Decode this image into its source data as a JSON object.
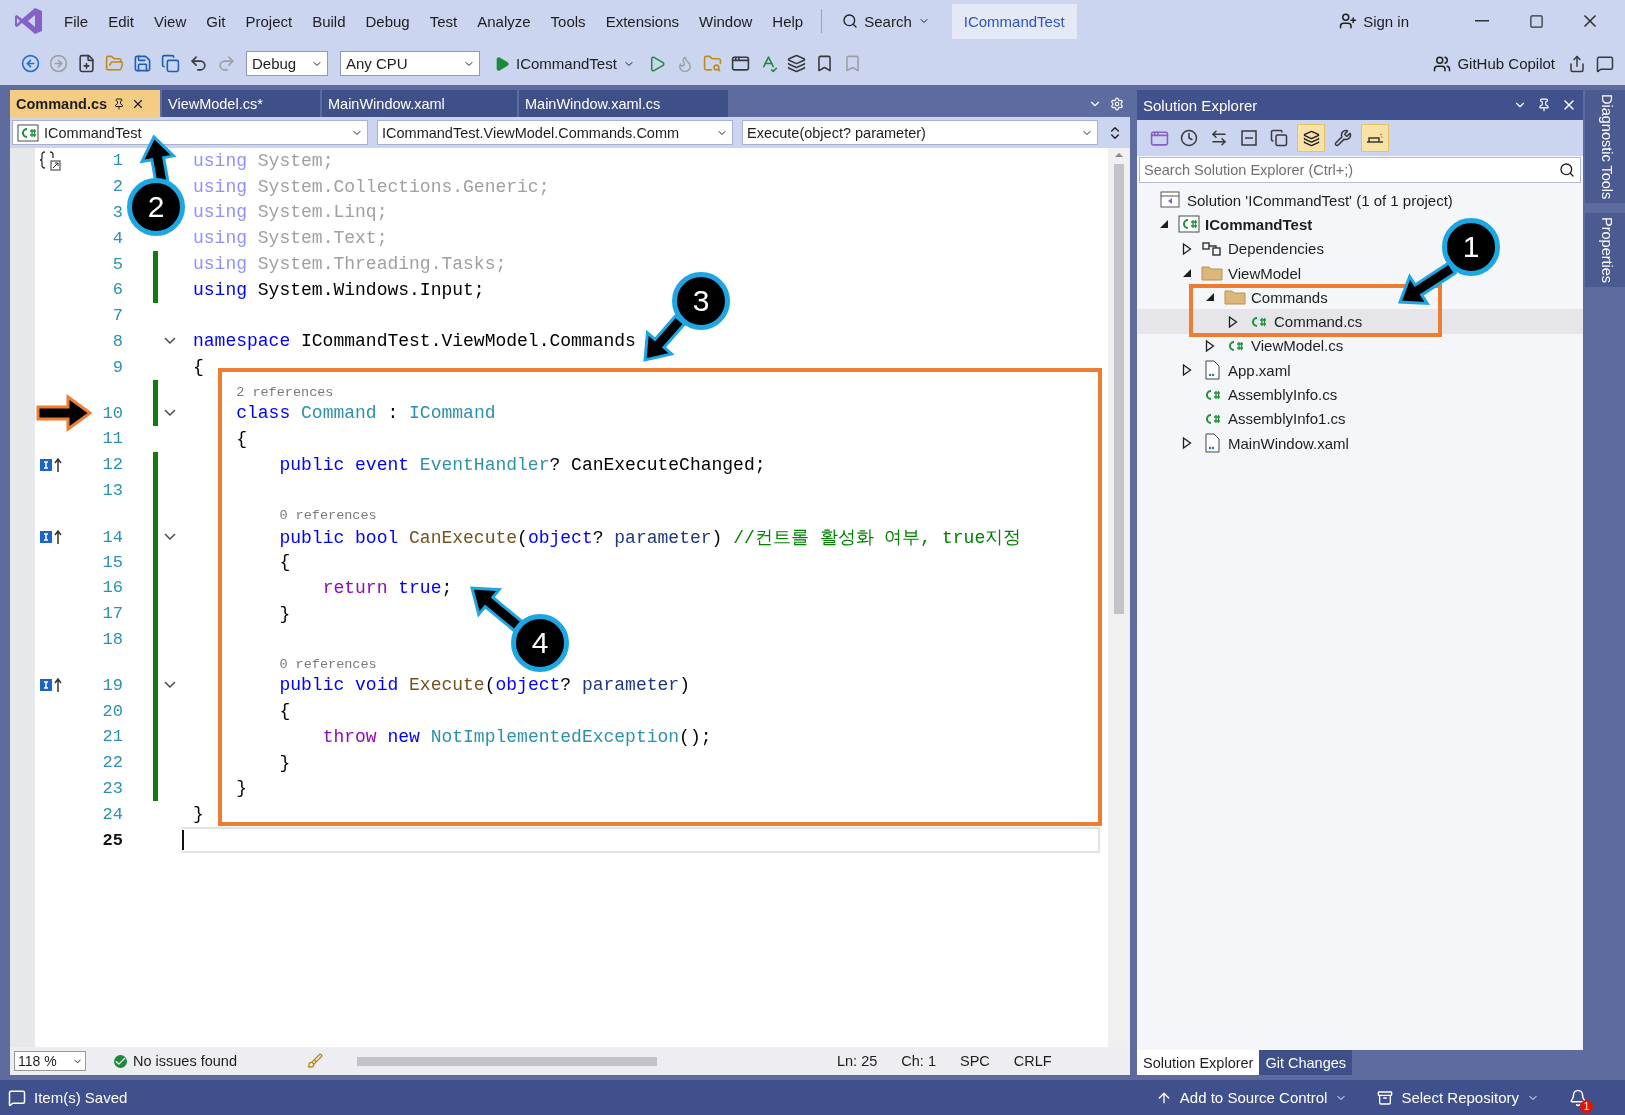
{
  "window": {
    "menu": [
      "File",
      "Edit",
      "View",
      "Git",
      "Project",
      "Build",
      "Debug",
      "Test",
      "Analyze",
      "Tools",
      "Extensions",
      "Window",
      "Help"
    ],
    "search": "Search",
    "solution_name": "ICommandTest",
    "sign_in": "Sign in"
  },
  "toolbar": {
    "configuration": "Debug",
    "platform": "Any CPU",
    "startup_project": "ICommandTest",
    "copilot": "GitHub Copilot"
  },
  "document_tabs": [
    {
      "label": "Command.cs",
      "selected": true
    },
    {
      "label": "ViewModel.cs*",
      "selected": false
    },
    {
      "label": "MainWindow.xaml",
      "selected": false
    },
    {
      "label": "MainWindow.xaml.cs",
      "selected": false
    }
  ],
  "navigation_bar": {
    "project": "ICommandTest",
    "type": "ICommandTest.ViewModel.Commands.Comm",
    "member": "Execute(object? parameter)"
  },
  "code_lines": [
    {
      "kind": "code",
      "number": "1",
      "changed": false,
      "current": false,
      "margin_icon": {
        "kind": "usings"
      },
      "tokens": [
        {
          "text": "using",
          "color": "#9090ff"
        },
        {
          "text": " System;",
          "color": "#a0a0a0"
        }
      ]
    },
    {
      "kind": "code",
      "number": "2",
      "changed": false,
      "current": false,
      "tokens": [
        {
          "text": "using",
          "color": "#9090ff"
        },
        {
          "text": " System.Collections.Generic;",
          "color": "#a0a0a0"
        }
      ]
    },
    {
      "kind": "code",
      "number": "3",
      "changed": false,
      "current": false,
      "tokens": [
        {
          "text": "using",
          "color": "#9090ff"
        },
        {
          "text": " System.Linq;",
          "color": "#a0a0a0"
        }
      ]
    },
    {
      "kind": "code",
      "number": "4",
      "changed": false,
      "current": false,
      "tokens": [
        {
          "text": "using",
          "color": "#9090ff"
        },
        {
          "text": " System.Text;",
          "color": "#a0a0a0"
        }
      ]
    },
    {
      "kind": "code",
      "number": "5",
      "changed": true,
      "current": false,
      "tokens": [
        {
          "text": "using",
          "color": "#9090ff"
        },
        {
          "text": " System.Threading.Tasks;",
          "color": "#a0a0a0"
        }
      ]
    },
    {
      "kind": "code",
      "number": "6",
      "changed": true,
      "current": false,
      "tokens": [
        {
          "text": "using",
          "color": "#0000ff"
        },
        {
          "text": " System.Windows.Input;",
          "color": "#000000"
        }
      ]
    },
    {
      "kind": "code",
      "number": "7",
      "changed": false,
      "current": false
    },
    {
      "kind": "code",
      "number": "8",
      "changed": false,
      "current": false,
      "expanded": true,
      "tokens": [
        {
          "text": "namespace",
          "color": "#0000ff"
        },
        {
          "text": " ICommandTest.ViewModel.Commands",
          "color": "#000000"
        }
      ]
    },
    {
      "kind": "code",
      "number": "9",
      "changed": false,
      "current": false,
      "tokens": [
        {
          "text": "{",
          "color": "#000000"
        }
      ]
    },
    {
      "kind": "lens",
      "changed": true,
      "text": "    2 references"
    },
    {
      "kind": "code",
      "number": "10",
      "changed": true,
      "current": false,
      "expanded": true,
      "tokens": [
        {
          "text": "    class",
          "color": "#0000ff"
        },
        {
          "text": " Command",
          "color": "#2b91af"
        },
        {
          "text": " :",
          "color": "#000000"
        },
        {
          "text": " ICommand",
          "color": "#2b91af"
        }
      ]
    },
    {
      "kind": "code",
      "number": "11",
      "changed": false,
      "current": false,
      "tokens": [
        {
          "text": "    {",
          "color": "#000000"
        }
      ]
    },
    {
      "kind": "code",
      "number": "12",
      "changed": true,
      "current": false,
      "margin_icon": {
        "kind": "implements"
      },
      "tokens": [
        {
          "text": "        public",
          "color": "#0000ff"
        },
        {
          "text": " event",
          "color": "#0000ff"
        },
        {
          "text": " EventHandler",
          "color": "#2b91af"
        },
        {
          "text": "? CanExecuteChanged;",
          "color": "#000000"
        }
      ]
    },
    {
      "kind": "code",
      "number": "13",
      "changed": true,
      "current": false
    },
    {
      "kind": "lens",
      "changed": true,
      "text": "        0 references"
    },
    {
      "kind": "code",
      "number": "14",
      "changed": true,
      "current": false,
      "expanded": true,
      "margin_icon": {
        "kind": "implements"
      },
      "tokens": [
        {
          "text": "        public",
          "color": "#0000ff"
        },
        {
          "text": " bool",
          "color": "#0000ff"
        },
        {
          "text": " CanExecute",
          "color": "#74531f"
        },
        {
          "text": "(",
          "color": "#000000"
        },
        {
          "text": "object",
          "color": "#0000ff"
        },
        {
          "text": "?",
          "color": "#000000"
        },
        {
          "text": " parameter",
          "color": "#1f377f"
        },
        {
          "text": ")",
          "color": "#000000"
        },
        {
          "text": " //컨트롤 활성화 여부, true지정",
          "color": "#008000"
        }
      ]
    },
    {
      "kind": "code",
      "number": "15",
      "changed": true,
      "current": false,
      "tokens": [
        {
          "text": "        {",
          "color": "#000000"
        }
      ]
    },
    {
      "kind": "code",
      "number": "16",
      "changed": true,
      "current": false,
      "tokens": [
        {
          "text": "            return",
          "color": "#8f08c4"
        },
        {
          "text": " true",
          "color": "#0000ff"
        },
        {
          "text": ";",
          "color": "#000000"
        }
      ]
    },
    {
      "kind": "code",
      "number": "17",
      "changed": true,
      "current": false,
      "tokens": [
        {
          "text": "        }",
          "color": "#000000"
        }
      ]
    },
    {
      "kind": "code",
      "number": "18",
      "changed": true,
      "current": false
    },
    {
      "kind": "lens",
      "changed": true,
      "text": "        0 references"
    },
    {
      "kind": "code",
      "number": "19",
      "changed": true,
      "current": false,
      "expanded": true,
      "margin_icon": {
        "kind": "implements"
      },
      "tokens": [
        {
          "text": "        public",
          "color": "#0000ff"
        },
        {
          "text": " void",
          "color": "#0000ff"
        },
        {
          "text": " Execute",
          "color": "#74531f"
        },
        {
          "text": "(",
          "color": "#000000"
        },
        {
          "text": "object",
          "color": "#0000ff"
        },
        {
          "text": "?",
          "color": "#000000"
        },
        {
          "text": " parameter",
          "color": "#1f377f"
        },
        {
          "text": ")",
          "color": "#000000"
        }
      ]
    },
    {
      "kind": "code",
      "number": "20",
      "changed": true,
      "current": false,
      "tokens": [
        {
          "text": "        {",
          "color": "#000000"
        }
      ]
    },
    {
      "kind": "code",
      "number": "21",
      "changed": true,
      "current": false,
      "tokens": [
        {
          "text": "            throw",
          "color": "#8f08c4"
        },
        {
          "text": " new",
          "color": "#0000ff"
        },
        {
          "text": " NotImplementedException",
          "color": "#2b91af"
        },
        {
          "text": "();",
          "color": "#000000"
        }
      ]
    },
    {
      "kind": "code",
      "number": "22",
      "changed": true,
      "current": false,
      "tokens": [
        {
          "text": "        }",
          "color": "#000000"
        }
      ]
    },
    {
      "kind": "code",
      "number": "23",
      "changed": true,
      "current": false,
      "tokens": [
        {
          "text": "    }",
          "color": "#000000"
        }
      ]
    },
    {
      "kind": "code",
      "number": "24",
      "changed": false,
      "current": false,
      "tokens": [
        {
          "text": "}",
          "color": "#000000"
        }
      ]
    },
    {
      "kind": "code",
      "number": "25",
      "changed": false,
      "current": true
    }
  ],
  "editor_status": {
    "zoom": "118 %",
    "issues": "No issues found",
    "line": "Ln: 25",
    "column": "Ch: 1",
    "whitespace": "SPC",
    "line_ending": "CRLF"
  },
  "solution_explorer": {
    "title": "Solution Explorer",
    "search_placeholder": "Search Solution Explorer (Ctrl+;)",
    "tree": [
      {
        "label": "Solution 'ICommandTest' (1 of 1 project)",
        "kind": "solution",
        "selected": false,
        "children": [
          {
            "label": "ICommandTest",
            "kind": "project",
            "expanded": true,
            "selected": false,
            "children": [
              {
                "label": "Dependencies",
                "kind": "dependencies",
                "expanded": false,
                "selected": false
              },
              {
                "label": "ViewModel",
                "kind": "folder",
                "expanded": true,
                "selected": false,
                "children": [
                  {
                    "label": "Commands",
                    "kind": "folder",
                    "expanded": true,
                    "selected": false,
                    "children": [
                      {
                        "label": "Command.cs",
                        "kind": "csharp",
                        "expanded": false,
                        "selected": true
                      }
                    ]
                  },
                  {
                    "label": "ViewModel.cs",
                    "kind": "csharp",
                    "expanded": false,
                    "selected": false
                  }
                ]
              },
              {
                "label": "App.xaml",
                "kind": "xaml",
                "expanded": false,
                "selected": false
              },
              {
                "label": "AssemblyInfo.cs",
                "kind": "csharp",
                "selected": false
              },
              {
                "label": "AssemblyInfo1.cs",
                "kind": "csharp",
                "selected": false
              },
              {
                "label": "MainWindow.xaml",
                "kind": "xaml",
                "expanded": false,
                "selected": false
              }
            ]
          }
        ]
      }
    ],
    "tabs": [
      {
        "label": "Solution Explorer",
        "selected": true
      },
      {
        "label": "Git Changes",
        "selected": false
      }
    ]
  },
  "side_tabs": [
    "Diagnostic Tools",
    "Properties"
  ],
  "status_bar": {
    "message": "Item(s) Saved",
    "source_control": "Add to Source Control",
    "repository": "Select Repository",
    "notifications": "1"
  },
  "annotations": {
    "callouts": [
      "1",
      "2",
      "3",
      "4"
    ]
  }
}
